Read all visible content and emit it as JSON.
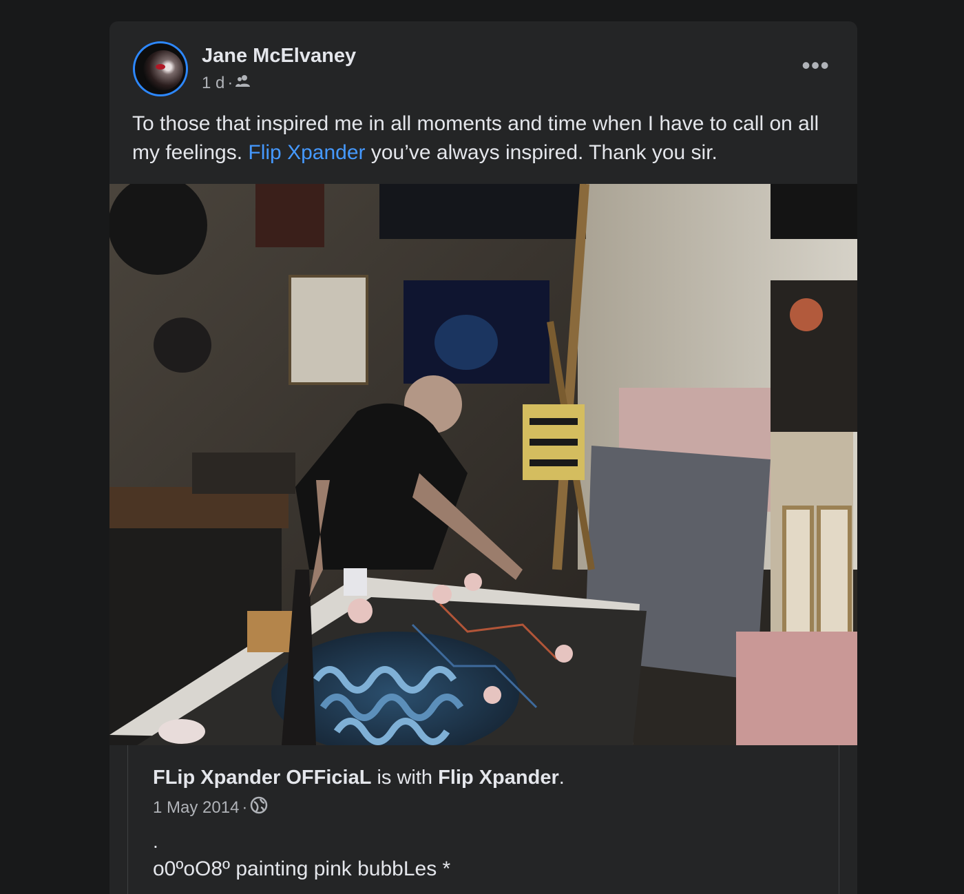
{
  "post": {
    "author": "Jane McElvaney",
    "time": "1 d",
    "separator": "·",
    "audience_icon": "friends-icon",
    "more_icon": "more-options-icon",
    "more_label": "•••",
    "text_before": "To those that inspired me in all moments and time when I have to call on all my feelings. ",
    "mention": "Flip Xpander",
    "text_after": " you’ve always inspired. Thank you sir."
  },
  "shared": {
    "page_name": "FLip Xpander OFFiciaL",
    "with_text": " is with ",
    "tagged": "Flip Xpander",
    "period": ".",
    "date": "1 May 2014",
    "separator": "·",
    "privacy_icon": "globe-icon",
    "dot_line": ".",
    "body": "o0ºoO8º painting pink bubbLes *"
  },
  "colors": {
    "background": "#18191a",
    "card": "#242526",
    "text": "#e4e6eb",
    "secondary_text": "#b0b3b8",
    "link": "#4599ff",
    "avatar_ring": "#2d88ff"
  }
}
